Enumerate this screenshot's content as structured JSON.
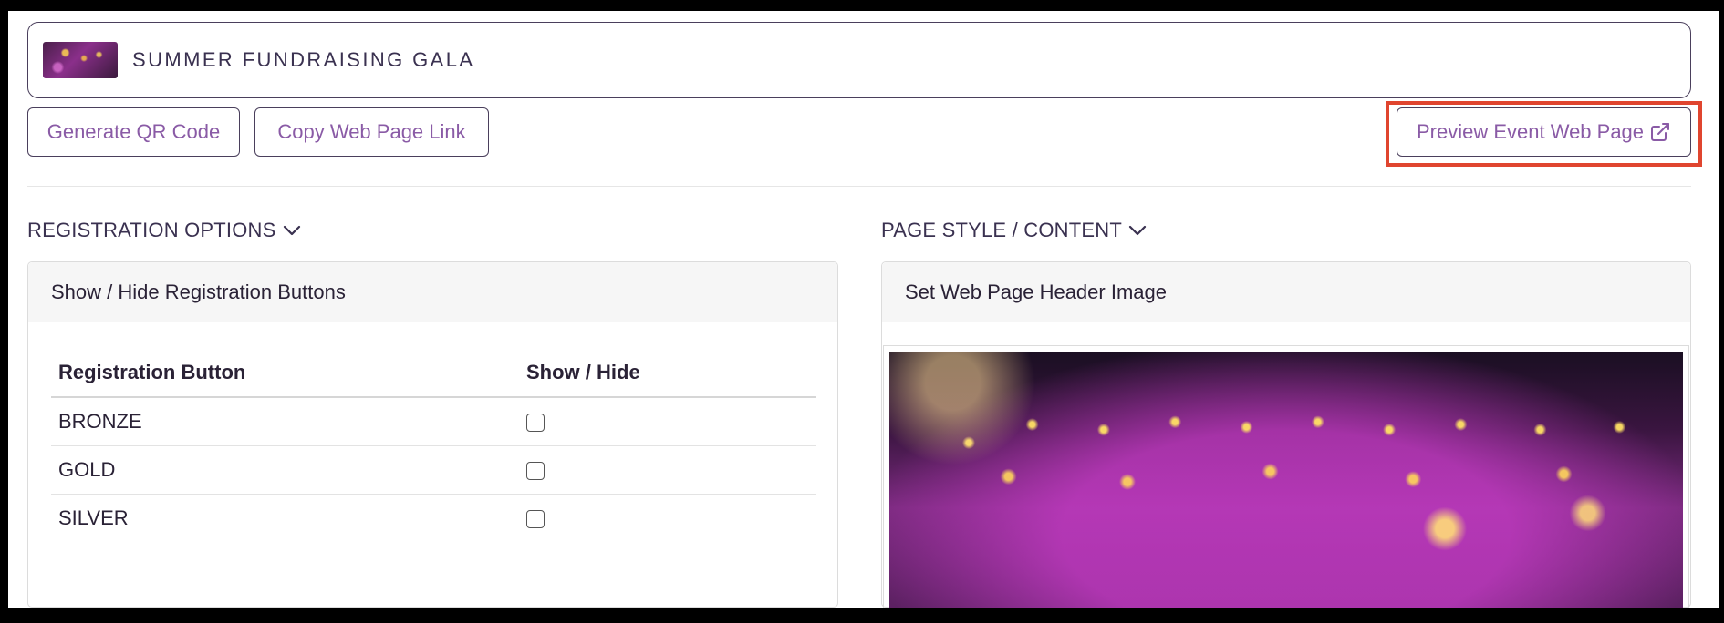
{
  "event": {
    "title": "SUMMER FUNDRAISING GALA"
  },
  "actions": {
    "generate_qr": "Generate QR Code",
    "copy_link": "Copy Web Page Link",
    "preview": "Preview Event Web Page"
  },
  "sections": {
    "registration": {
      "title": "REGISTRATION OPTIONS",
      "card_title": "Show / Hide Registration Buttons",
      "columns": [
        "Registration Button",
        "Show / Hide"
      ],
      "rows": [
        {
          "name": "BRONZE",
          "shown": false
        },
        {
          "name": "GOLD",
          "shown": false
        },
        {
          "name": "SILVER",
          "shown": false
        }
      ]
    },
    "page_style": {
      "title": "PAGE STYLE / CONTENT",
      "card_title": "Set Web Page Header Image"
    }
  },
  "colors": {
    "accent": "#8a5ba6",
    "highlight": "#e0452f",
    "text": "#2a2236"
  },
  "icons": {
    "external_link": "external-link-icon",
    "chevron": "chevron-down-icon"
  }
}
